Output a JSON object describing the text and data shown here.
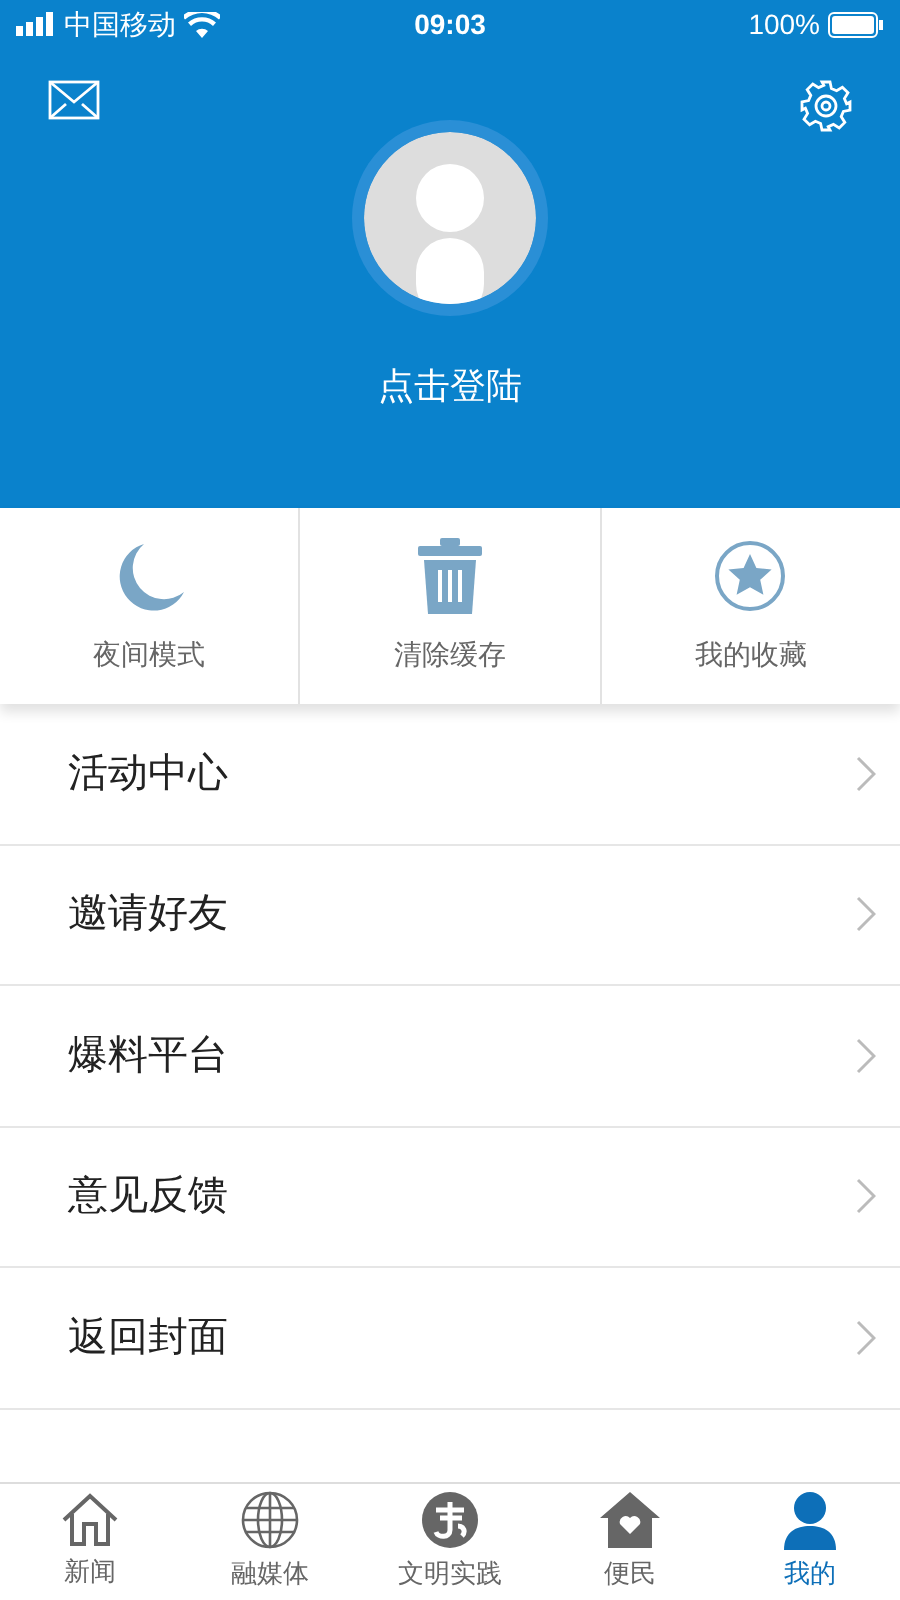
{
  "status_bar": {
    "carrier": "中国移动",
    "time": "09:03",
    "battery": "100%"
  },
  "header": {
    "login": "点击登陆"
  },
  "quick_actions": [
    {
      "label": "夜间模式"
    },
    {
      "label": "清除缓存"
    },
    {
      "label": "我的收藏"
    }
  ],
  "menu": [
    {
      "label": "活动中心"
    },
    {
      "label": "邀请好友"
    },
    {
      "label": "爆料平台"
    },
    {
      "label": "意见反馈"
    },
    {
      "label": "返回封面"
    }
  ],
  "tabs": [
    {
      "label": "新闻",
      "selected": false
    },
    {
      "label": "融媒体",
      "selected": false
    },
    {
      "label": "文明实践",
      "selected": false
    },
    {
      "label": "便民",
      "selected": false
    },
    {
      "label": "我的",
      "selected": true
    }
  ]
}
